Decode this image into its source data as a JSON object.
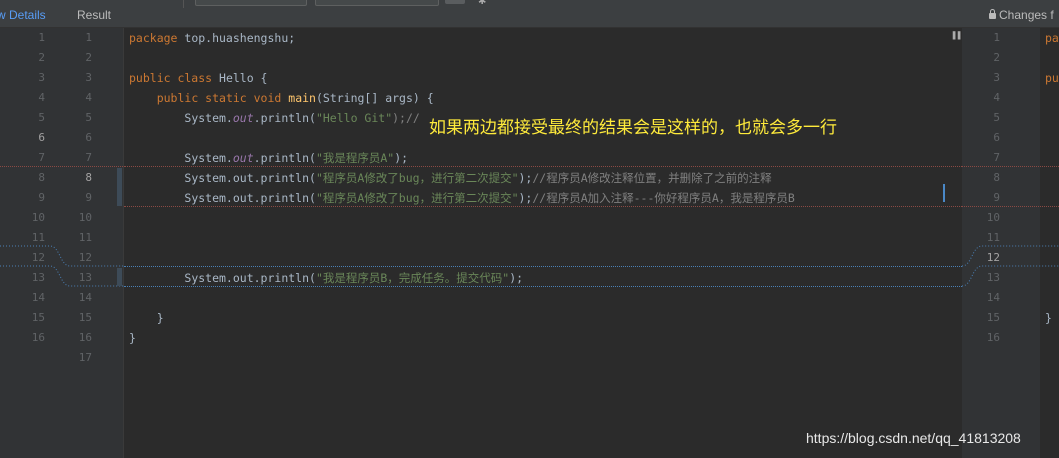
{
  "tabs": {
    "view_details": "w Details",
    "result": "Result"
  },
  "changes_label": "Changes f",
  "annotation": "如果两边都接受最终的结果会是这样的，也就会多一行",
  "watermark": "https://blog.csdn.net/qq_41813208",
  "left_line_numbers": [
    "1",
    "2",
    "3",
    "4",
    "5",
    "6",
    "7",
    "8",
    "9",
    "10",
    "11",
    "12",
    "13",
    "14",
    "15",
    "16"
  ],
  "middle_line_numbers": [
    "1",
    "2",
    "3",
    "4",
    "5",
    "6",
    "7",
    "8",
    "9",
    "10",
    "11",
    "12",
    "13",
    "14",
    "15",
    "16",
    "17"
  ],
  "right_line_numbers": [
    "1",
    "2",
    "3",
    "4",
    "5",
    "6",
    "7",
    "8",
    "9",
    "10",
    "11",
    "12",
    "13",
    "14",
    "15",
    "16"
  ],
  "code": {
    "l1_kw": "package",
    "l1_rest": " top.huashengshu;",
    "l3_kw": "public class",
    "l3_rest": " Hello {",
    "l4_kw": "public static void",
    "l4_fn": "main",
    "l4_rest": "(String[] args) {",
    "l5_a": "System.",
    "l5_out": "out",
    "l5_b": ".println(",
    "l5_str": "\"Hello Git\"",
    "l5_c": ");//",
    "l7_a": "System.",
    "l7_out": "out",
    "l7_b": ".println(",
    "l7_str": "\"我是程序员A\"",
    "l7_c": ");",
    "l8_a": "System.out.println(",
    "l8_str": "\"程序员A修改了bug，进行第二次提交\"",
    "l8_b": ");",
    "l8_cm": "//程序员A修改注释位置，并删除了之前的注释",
    "l9_a": "System.out.println(",
    "l9_str": "\"程序员A修改了bug，进行第二次提交\"",
    "l9_b": ");",
    "l9_cm": "//程序员A加入注释---你好程序员A，我是程序员B",
    "l13_a": "System.out.println(",
    "l13_str": "\"我是程序员B，完成任务。提交代码\"",
    "l13_b": ");",
    "l15": "}",
    "l16": "}"
  },
  "right_code": {
    "r1": "pa",
    "r3": "pu",
    "r15": "}"
  }
}
